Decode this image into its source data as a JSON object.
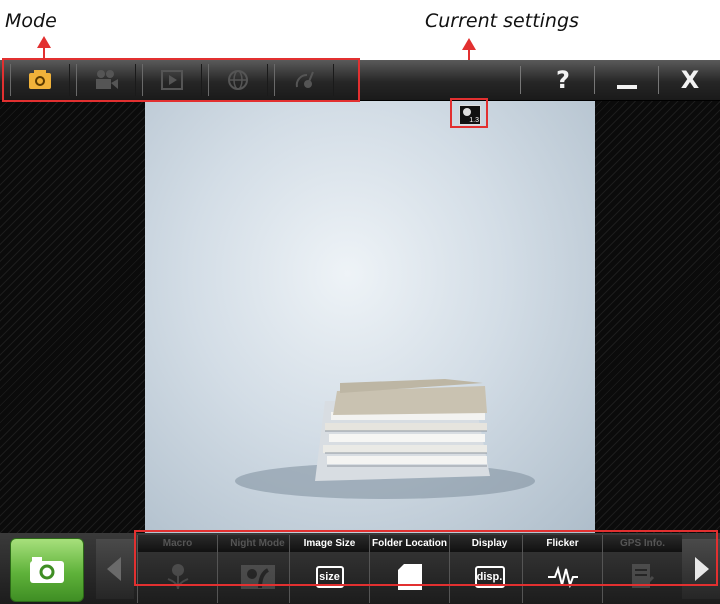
{
  "annotations": {
    "mode": "Mode",
    "current_settings": "Current settings"
  },
  "toolbar": {
    "modes": [
      {
        "icon": "camera-icon",
        "active": true
      },
      {
        "icon": "video-camera-icon",
        "active": false
      },
      {
        "icon": "playback-icon",
        "active": false
      },
      {
        "icon": "webcam-icon",
        "active": false
      },
      {
        "icon": "satellite-icon",
        "active": false
      }
    ],
    "help_label": "?",
    "minimize_label": "_",
    "close_label": "X"
  },
  "current_settings_icon": {
    "sub_label": "1.3"
  },
  "bottom": {
    "settings": [
      {
        "label": "Macro",
        "enabled": false,
        "icon": "macro-flower-icon"
      },
      {
        "label": "Night Mode",
        "enabled": false,
        "icon": "night-mode-icon"
      },
      {
        "label": "Image Size",
        "enabled": true,
        "icon": "size-icon",
        "icon_text": "size"
      },
      {
        "label": "Folder Location",
        "enabled": true,
        "icon": "folder-icon"
      },
      {
        "label": "Display",
        "enabled": true,
        "icon": "display-icon",
        "icon_text": "disp."
      },
      {
        "label": "Flicker",
        "enabled": true,
        "icon": "flicker-wave-icon"
      },
      {
        "label": "GPS Info.",
        "enabled": false,
        "icon": "gps-info-icon"
      }
    ]
  },
  "colors": {
    "active_mode": "#f0b23a",
    "shutter_green": "#5fb23a",
    "annotation_red": "#e23030"
  }
}
